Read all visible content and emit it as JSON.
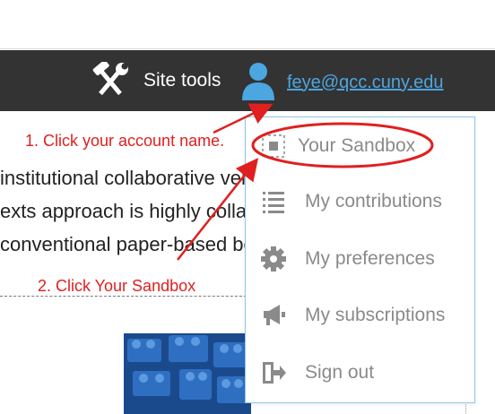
{
  "header": {
    "site_tools_label": "Site tools",
    "account_name": "feye@qcc.cuny.edu",
    "accent_link_color": "#4ca6e0",
    "bar_color": "#333333"
  },
  "page": {
    "text_lines": [
      "institutional collaborative venture to develop the",
      "exts approach is highly collaborative where all",
      "conventional paper-based books."
    ]
  },
  "menu": {
    "items": [
      {
        "label": "Your Sandbox",
        "icon": "sandbox-icon"
      },
      {
        "label": "My contributions",
        "icon": "list-icon"
      },
      {
        "label": "My preferences",
        "icon": "gear-icon"
      },
      {
        "label": "My subscriptions",
        "icon": "megaphone-icon"
      },
      {
        "label": "Sign out",
        "icon": "sign-out-icon"
      }
    ]
  },
  "annotations": {
    "step1": "1. Click your account name.",
    "step2": "2. Click Your Sandbox",
    "color": "#e02020"
  }
}
